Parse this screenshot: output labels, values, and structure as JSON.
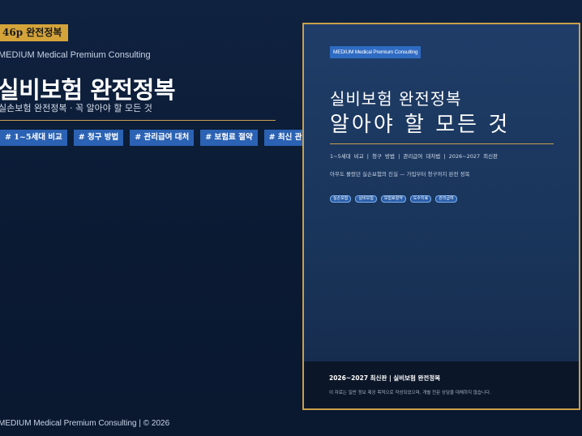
{
  "page_badge": "46p 완전정복",
  "brand": "MEDIUM Medical Premium Consulting",
  "title": "실비보험 완전정복",
  "subtitle": "실손보험 완전정복 · 꼭 알아야 할 모든 것",
  "tags": [
    "# 1~5세대 비교",
    "# 청구 방법",
    "# 관리급여 대처",
    "# 보험료 절약",
    "# 최신 관리급여 대처"
  ],
  "footer": "MEDIUM Medical Premium Consulting | © 2026",
  "cover": {
    "badge": "MEDIUM Medical Premium Consulting",
    "title_line1": "실비보험 완전정복",
    "title_line2": "알아야 할 모든 것",
    "meta": "1~5세대 비교 | 청구 방법 | 관리급여 대처법 | 2026~2027 최신판",
    "description": "아무도 몰랐던 실손보험의 진실 — 가입부터 청구까지 완전 정복",
    "chips": [
      "실손보험",
      "실비보험",
      "보험료절약",
      "도수치료",
      "관리급여"
    ],
    "bottom_title": "2026~2027 최신판 | 실비보험 완전정복",
    "bottom_note": "이 자료는 일반 정보 제공 목적으로 작성되었으며, 개별 전문 상담을 대체하지 않습니다."
  },
  "colors": {
    "background": "#0f2240",
    "gold": "#c9a04a",
    "badge_gold": "#d4a43a",
    "tag_blue": "#2b62b3",
    "cover_blue": "#1f3d68"
  }
}
